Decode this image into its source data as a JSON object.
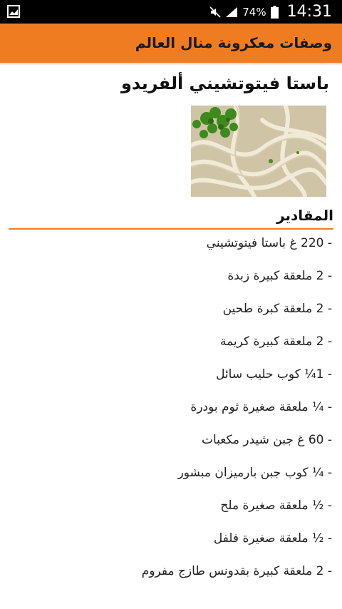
{
  "status_bar": {
    "battery_percent": "74%",
    "time": "14:31"
  },
  "app_bar": {
    "title": "وصفات معكرونة منال العالم"
  },
  "recipe": {
    "title": "باستا فيتوتشيني ألفريدو",
    "image_alt": "pasta-fettuccine-alfredo-photo",
    "section_heading": "المقادير",
    "ingredients": [
      "- 220 غ باستا فيتوتشيني",
      "- 2 ملعقة كبيرة زبدة",
      "- 2 ملعقة كبرة طحين",
      "- 2 ملعقة كبيرة كريمة",
      "- 1¼ كوب حليب سائل",
      "- ¼ ملعقة صغيرة ثوم بودرة",
      "- 60 غ جبن شيدر مكعبات",
      "- ¼ كوب جبن بارميزان مبشور",
      "- ½ ملعقة صغيرة ملح",
      "- ½ ملعقة صغيرة فلفل",
      "- 2 ملعقة كبيرة بقدونس طازج مفروم"
    ]
  },
  "colors": {
    "accent": "#f07c22",
    "status_bar": "#000000"
  }
}
